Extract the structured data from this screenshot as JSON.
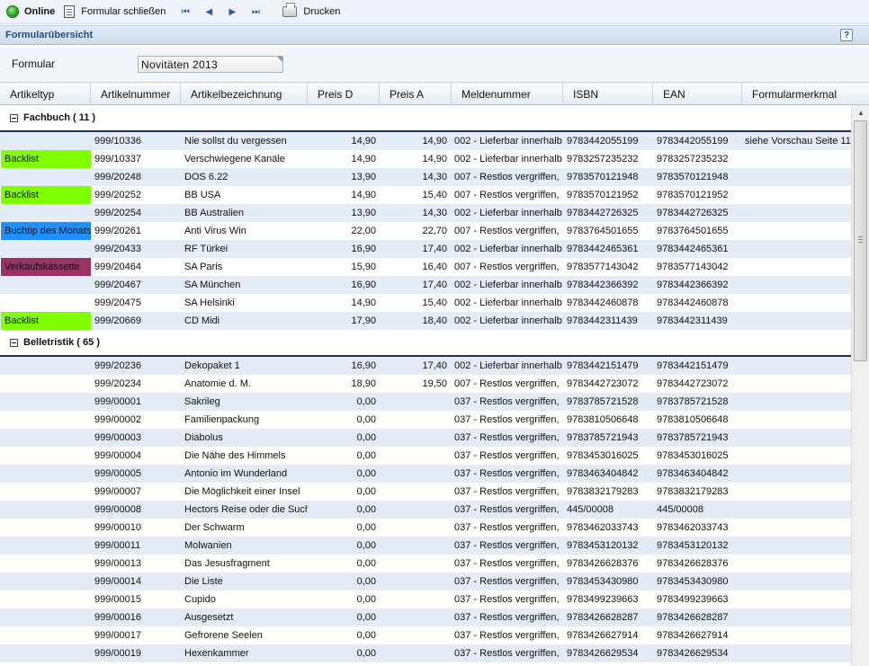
{
  "toolbar": {
    "online_label": "Online",
    "close_label": "Formular schließen",
    "print_label": "Drucken",
    "nav_first": "⏮",
    "nav_prev": "◀",
    "nav_next": "▶",
    "nav_last": "⏭"
  },
  "section": {
    "title": "Formularübersicht",
    "help_label": "?"
  },
  "form": {
    "label": "Formular",
    "value": "Novitäten 2013"
  },
  "columns": [
    "Artikeltyp",
    "Artikelnummer",
    "Artikelbezeichnung",
    "Preis D",
    "Preis A",
    "Meldenummer",
    "ISBN",
    "EAN",
    "Formularmerkmal"
  ],
  "colors": {
    "Backlist": "#7fff00",
    "Buchtip des Monats": "#1e90ff",
    "Verkaufskassette": "#993366"
  },
  "groups": [
    {
      "label": "Fachbuch ( 11 )",
      "rows": [
        {
          "typ": "",
          "nr": "999/10336",
          "bez": "Nie sollst du vergessen",
          "pd": "14,90",
          "pa": "14,90",
          "mn": "002 - Lieferbar innerhalb",
          "isbn": "9783442055199",
          "ean": "9783442055199",
          "fm": "siehe Vorschau Seite 11"
        },
        {
          "typ": "Backlist",
          "nr": "999/10337",
          "bez": "Verschwiegene Kanäle",
          "pd": "14,90",
          "pa": "14,90",
          "mn": "002 - Lieferbar innerhalb",
          "isbn": "9783257235232",
          "ean": "9783257235232",
          "fm": ""
        },
        {
          "typ": "",
          "nr": "999/20248",
          "bez": "DOS 6.22",
          "pd": "13,90",
          "pa": "14,30",
          "mn": "007 - Restlos vergriffen,",
          "isbn": "9783570121948",
          "ean": "9783570121948",
          "fm": ""
        },
        {
          "typ": "Backlist",
          "nr": "999/20252",
          "bez": "BB USA",
          "pd": "14,90",
          "pa": "15,40",
          "mn": "007 - Restlos vergriffen,",
          "isbn": "9783570121952",
          "ean": "9783570121952",
          "fm": ""
        },
        {
          "typ": "",
          "nr": "999/20254",
          "bez": "BB Australien",
          "pd": "13,90",
          "pa": "14,30",
          "mn": "002 - Lieferbar innerhalb",
          "isbn": "9783442726325",
          "ean": "9783442726325",
          "fm": ""
        },
        {
          "typ": "Buchtip des Monats",
          "nr": "999/20261",
          "bez": "Anti Virus Win",
          "pd": "22,00",
          "pa": "22,70",
          "mn": "007 - Restlos vergriffen,",
          "isbn": "9783764501655",
          "ean": "9783764501655",
          "fm": ""
        },
        {
          "typ": "",
          "nr": "999/20433",
          "bez": "RF Türkei",
          "pd": "16,90",
          "pa": "17,40",
          "mn": "002 - Lieferbar innerhalb",
          "isbn": "9783442465361",
          "ean": "9783442465361",
          "fm": ""
        },
        {
          "typ": "Verkaufskassette",
          "nr": "999/20464",
          "bez": "SA Paris",
          "pd": "15,90",
          "pa": "16,40",
          "mn": "007 - Restlos vergriffen,",
          "isbn": "9783577143042",
          "ean": "9783577143042",
          "fm": ""
        },
        {
          "typ": "",
          "nr": "999/20467",
          "bez": "SA München",
          "pd": "16,90",
          "pa": "17,40",
          "mn": "002 - Lieferbar innerhalb",
          "isbn": "9783442366392",
          "ean": "9783442366392",
          "fm": ""
        },
        {
          "typ": "",
          "nr": "999/20475",
          "bez": "SA Helsinki",
          "pd": "14,90",
          "pa": "15,40",
          "mn": "002 - Lieferbar innerhalb",
          "isbn": "9783442460878",
          "ean": "9783442460878",
          "fm": ""
        },
        {
          "typ": "Backlist",
          "nr": "999/20669",
          "bez": "CD Midi",
          "pd": "17,90",
          "pa": "18,40",
          "mn": "002 - Lieferbar innerhalb",
          "isbn": "9783442311439",
          "ean": "9783442311439",
          "fm": ""
        }
      ]
    },
    {
      "label": "Belletristik ( 65 )",
      "rows": [
        {
          "typ": "",
          "nr": "999/20236",
          "bez": "Dekopaket 1",
          "pd": "16,90",
          "pa": "17,40",
          "mn": "002 - Lieferbar innerhalb",
          "isbn": "9783442151479",
          "ean": "9783442151479",
          "fm": ""
        },
        {
          "typ": "",
          "nr": "999/20234",
          "bez": "Anatomie d. M.",
          "pd": "18,90",
          "pa": "19,50",
          "mn": "007 - Restlos vergriffen,",
          "isbn": "9783442723072",
          "ean": "9783442723072",
          "fm": ""
        },
        {
          "typ": "",
          "nr": "999/00001",
          "bez": "Sakrileg",
          "pd": "0,00",
          "pa": "",
          "mn": "037 - Restlos vergriffen,",
          "isbn": "9783785721528",
          "ean": "9783785721528",
          "fm": ""
        },
        {
          "typ": "",
          "nr": "999/00002",
          "bez": "Familienpackung",
          "pd": "0,00",
          "pa": "",
          "mn": "037 - Restlos vergriffen,",
          "isbn": "9783810506648",
          "ean": "9783810506648",
          "fm": ""
        },
        {
          "typ": "",
          "nr": "999/00003",
          "bez": "Diabolus",
          "pd": "0,00",
          "pa": "",
          "mn": "037 - Restlos vergriffen,",
          "isbn": "9783785721943",
          "ean": "9783785721943",
          "fm": ""
        },
        {
          "typ": "",
          "nr": "999/00004",
          "bez": "Die Nähe des Himmels",
          "pd": "0,00",
          "pa": "",
          "mn": "037 - Restlos vergriffen,",
          "isbn": "9783453016025",
          "ean": "9783453016025",
          "fm": ""
        },
        {
          "typ": "",
          "nr": "999/00005",
          "bez": "Antonio im Wunderland",
          "pd": "0,00",
          "pa": "",
          "mn": "037 - Restlos vergriffen,",
          "isbn": "9783463404842",
          "ean": "9783463404842",
          "fm": ""
        },
        {
          "typ": "",
          "nr": "999/00007",
          "bez": "Die Möglichkeit einer Insel",
          "pd": "0,00",
          "pa": "",
          "mn": "037 - Restlos vergriffen,",
          "isbn": "9783832179283",
          "ean": "9783832179283",
          "fm": ""
        },
        {
          "typ": "",
          "nr": "999/00008",
          "bez": "Hectors Reise oder die Such",
          "pd": "0,00",
          "pa": "",
          "mn": "037 - Restlos vergriffen,",
          "isbn": "445/00008",
          "ean": "445/00008",
          "fm": ""
        },
        {
          "typ": "",
          "nr": "999/00010",
          "bez": "Der Schwarm",
          "pd": "0,00",
          "pa": "",
          "mn": "037 - Restlos vergriffen,",
          "isbn": "9783462033743",
          "ean": "9783462033743",
          "fm": ""
        },
        {
          "typ": "",
          "nr": "999/00011",
          "bez": "Molwanien",
          "pd": "0,00",
          "pa": "",
          "mn": "037 - Restlos vergriffen,",
          "isbn": "9783453120132",
          "ean": "9783453120132",
          "fm": ""
        },
        {
          "typ": "",
          "nr": "999/00013",
          "bez": "Das Jesusfragment",
          "pd": "0,00",
          "pa": "",
          "mn": "037 - Restlos vergriffen,",
          "isbn": "9783426628376",
          "ean": "9783426628376",
          "fm": ""
        },
        {
          "typ": "",
          "nr": "999/00014",
          "bez": "Die Liste",
          "pd": "0,00",
          "pa": "",
          "mn": "037 - Restlos vergriffen,",
          "isbn": "9783453430980",
          "ean": "9783453430980",
          "fm": ""
        },
        {
          "typ": "",
          "nr": "999/00015",
          "bez": "Cupido",
          "pd": "0,00",
          "pa": "",
          "mn": "037 - Restlos vergriffen,",
          "isbn": "9783499239663",
          "ean": "9783499239663",
          "fm": ""
        },
        {
          "typ": "",
          "nr": "999/00016",
          "bez": "Ausgesetzt",
          "pd": "0,00",
          "pa": "",
          "mn": "037 - Restlos vergriffen,",
          "isbn": "9783426628287",
          "ean": "9783426628287",
          "fm": ""
        },
        {
          "typ": "",
          "nr": "999/00017",
          "bez": "Gefrorene Seelen",
          "pd": "0,00",
          "pa": "",
          "mn": "037 - Restlos vergriffen,",
          "isbn": "9783426627914",
          "ean": "9783426627914",
          "fm": ""
        },
        {
          "typ": "",
          "nr": "999/00019",
          "bez": "Hexenkammer",
          "pd": "0,00",
          "pa": "",
          "mn": "037 - Restlos vergriffen,",
          "isbn": "9783426629534",
          "ean": "9783426629534",
          "fm": ""
        }
      ]
    }
  ]
}
